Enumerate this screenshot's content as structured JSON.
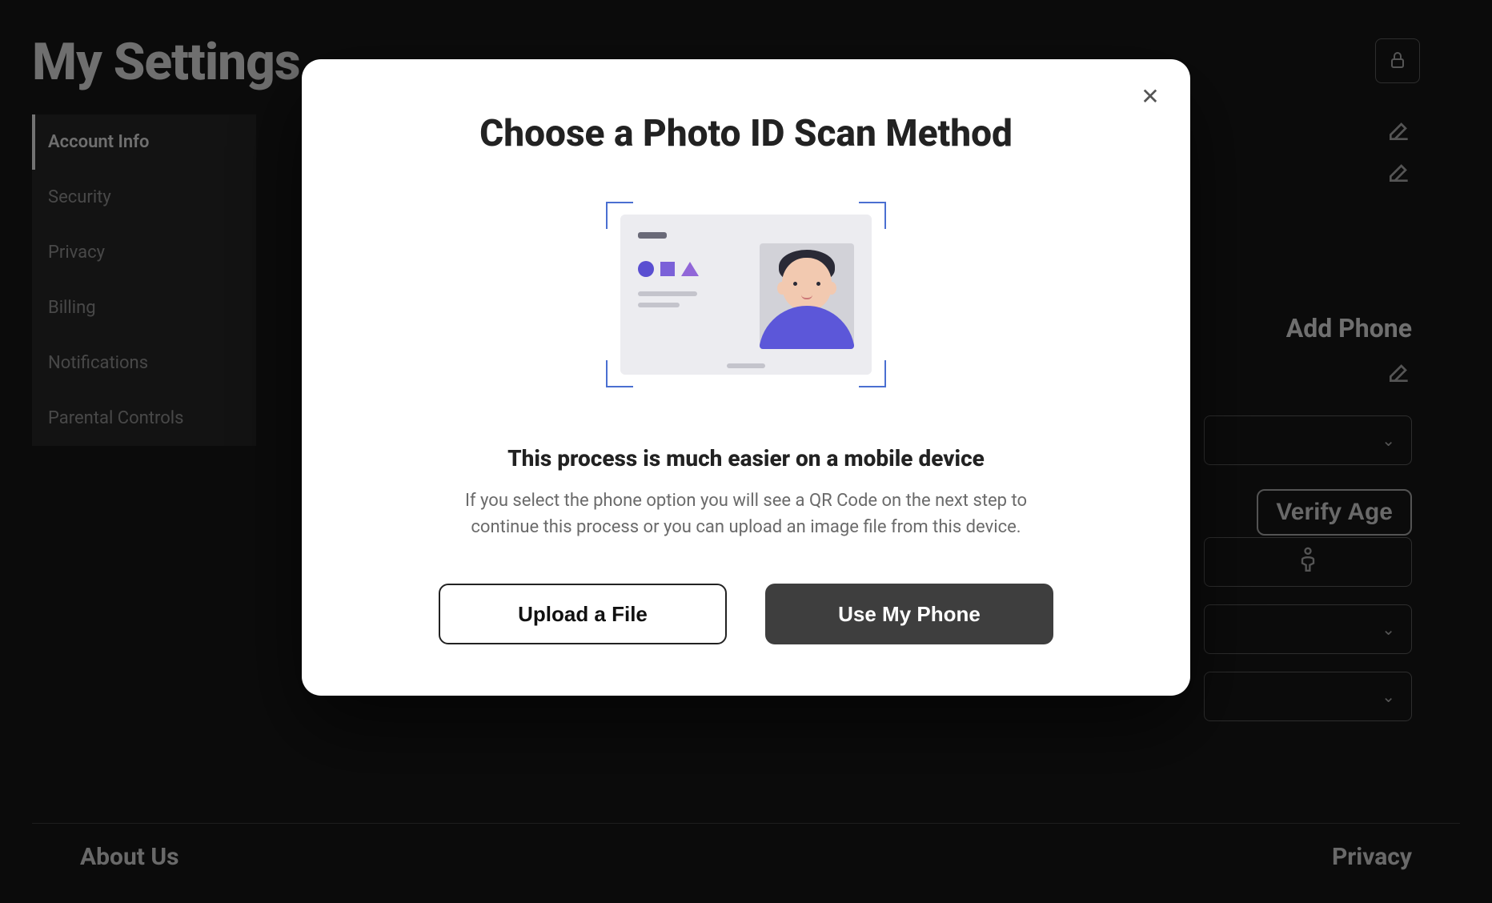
{
  "page": {
    "title": "My Settings"
  },
  "sidebar": {
    "items": [
      {
        "label": "Account Info",
        "active": true
      },
      {
        "label": "Security",
        "active": false
      },
      {
        "label": "Privacy",
        "active": false
      },
      {
        "label": "Billing",
        "active": false
      },
      {
        "label": "Notifications",
        "active": false
      },
      {
        "label": "Parental Controls",
        "active": false
      }
    ]
  },
  "right_panel": {
    "add_phone": "Add Phone",
    "verify_age": "Verify Age"
  },
  "footer": {
    "about": "About Us",
    "privacy": "Privacy"
  },
  "modal": {
    "title": "Choose a Photo ID Scan Method",
    "subheading": "This process is much easier on a mobile device",
    "subtext": "If you select the phone option you will see a QR Code on the next step to continue this process or you can upload an image file from this device.",
    "upload_label": "Upload a File",
    "phone_label": "Use My Phone"
  }
}
